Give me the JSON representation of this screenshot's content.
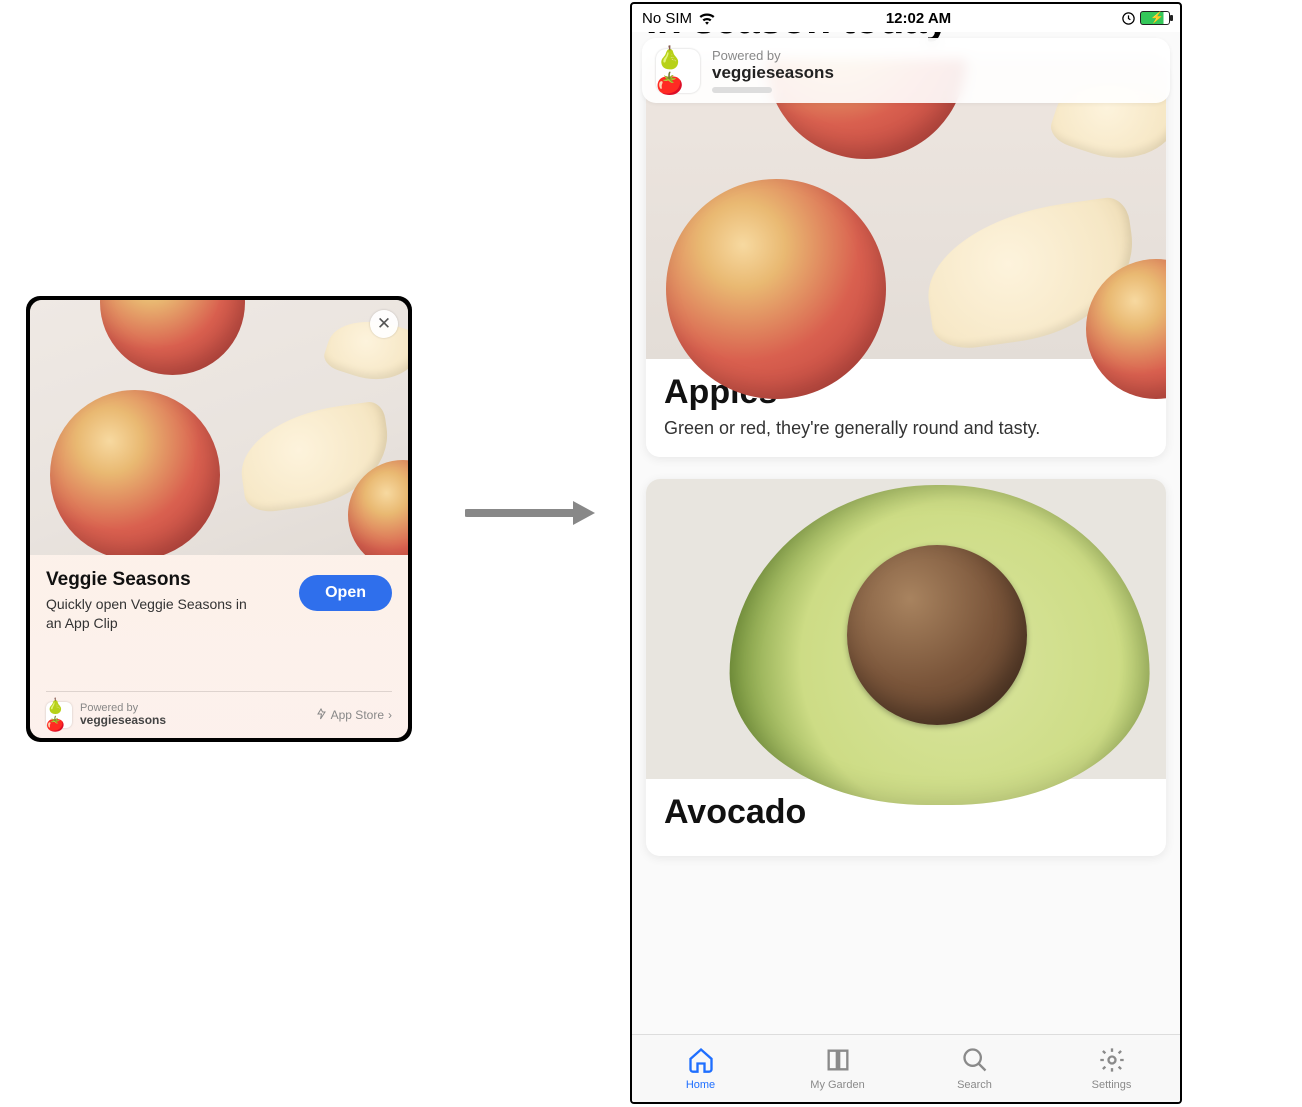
{
  "appclip": {
    "title": "Veggie Seasons",
    "subtitle": "Quickly open Veggie Seasons in an App Clip",
    "open_label": "Open",
    "close_glyph": "✕",
    "powered_by_label": "Powered by",
    "powered_by_name": "veggieseasons",
    "app_store_label": "App Store",
    "chevron": "›"
  },
  "phone": {
    "status": {
      "carrier": "No SIM",
      "time": "12:02 AM"
    },
    "banner": {
      "powered_by_label": "Powered by",
      "app_name": "veggieseasons"
    },
    "heading": "In season today",
    "cards": [
      {
        "title": "Apples",
        "subtitle": "Green or red, they're generally round and tasty."
      },
      {
        "title": "Avocado",
        "subtitle": ""
      }
    ],
    "tabs": [
      {
        "label": "Home",
        "active": true
      },
      {
        "label": "My Garden",
        "active": false
      },
      {
        "label": "Search",
        "active": false
      },
      {
        "label": "Settings",
        "active": false
      }
    ]
  },
  "icons": {
    "pear_tomato": "🍐🍅"
  }
}
